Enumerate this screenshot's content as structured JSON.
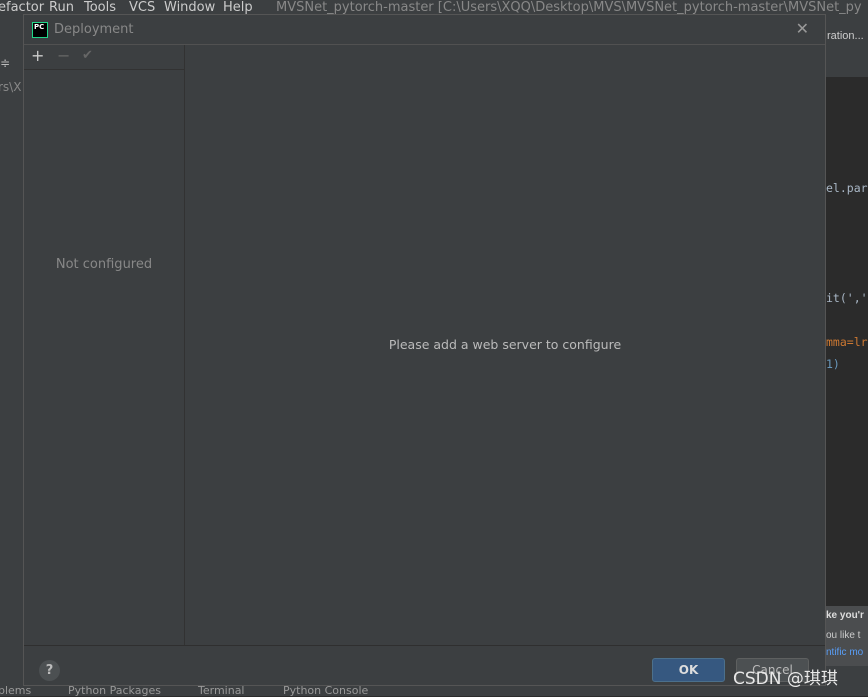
{
  "menubar": {
    "items": [
      "efactor",
      "Run",
      "Tools",
      "VCS",
      "Window",
      "Help"
    ],
    "title": "MVSNet_pytorch-master [C:\\Users\\XQQ\\Desktop\\MVS\\MVSNet_pytorch-master\\MVSNet_pytorch-master"
  },
  "background": {
    "config_label": "ration...",
    "path_fragment": "rs\\X",
    "code": [
      "el.par",
      "it(','",
      "mma=lr",
      "1)"
    ],
    "notification": {
      "title": "ke you'r",
      "line": "ou like t",
      "link": "ntific mo"
    },
    "bottom_tabs": [
      "blems",
      "Python Packages",
      "Terminal",
      "Python Console"
    ]
  },
  "dialog": {
    "title": "Deployment",
    "toolbar": {
      "add": "+",
      "remove": "−",
      "apply": "✔"
    },
    "left_empty": "Not configured",
    "message": "Please add a web server to configure",
    "help": "?",
    "ok": "OK",
    "cancel": "Cancel",
    "close": "✕"
  },
  "watermark": "CSDN @琪琪"
}
